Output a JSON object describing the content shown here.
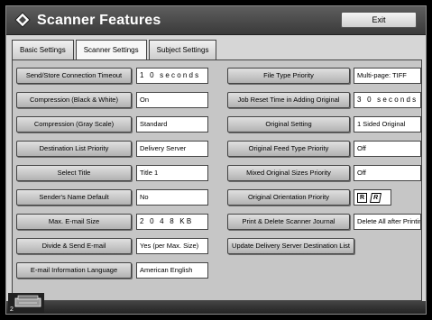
{
  "header": {
    "title": "Scanner Features",
    "exit_label": "Exit"
  },
  "tabs": [
    {
      "label": "Basic Settings",
      "active": false
    },
    {
      "label": "Scanner Settings",
      "active": true
    },
    {
      "label": "Subject Settings",
      "active": false
    }
  ],
  "left": [
    {
      "label": "Send/Store Connection Timeout",
      "value": "1 0 seconds"
    },
    {
      "label": "Compression (Black & White)",
      "value": "On"
    },
    {
      "label": "Compression (Gray Scale)",
      "value": "Standard"
    },
    {
      "label": "Destination List Priority",
      "value": "Delivery Server"
    },
    {
      "label": "Select Title",
      "value": "Title 1"
    },
    {
      "label": "Sender's Name Default",
      "value": "No"
    },
    {
      "label": "Max. E-mail Size",
      "value": "2 0 4 8 KB"
    },
    {
      "label": "Divide & Send E-mail",
      "value": "Yes (per Max. Size)"
    },
    {
      "label": "E-mail Information Language",
      "value": "American English"
    }
  ],
  "right": [
    {
      "label": "File Type Priority",
      "value": "Multi-page: TIFF"
    },
    {
      "label": "Job Reset Time in Adding Original",
      "value": "3 0 seconds"
    },
    {
      "label": "Original Setting",
      "value": "1 Sided Original"
    },
    {
      "label": "Original Feed Type Priority",
      "value": "Off"
    },
    {
      "label": "Mixed Original Sizes Priority",
      "value": "Off"
    },
    {
      "label": "Original Orientation Priority",
      "value": "R"
    },
    {
      "label": "Print & Delete Scanner Journal",
      "value": "Delete All after Printing"
    },
    {
      "label": "Update Delivery Server Destination List"
    }
  ],
  "footer": {
    "counter": "2"
  },
  "colors": {
    "header_bg": "#4a4a4a",
    "panel_bg": "#c6c6c6",
    "button_bg": "#c8c8c8",
    "value_bg": "#ffffff"
  },
  "icons": {
    "header": "diamond-icon",
    "orientation": "orientation-r-icon",
    "footer": "machine-icon"
  }
}
